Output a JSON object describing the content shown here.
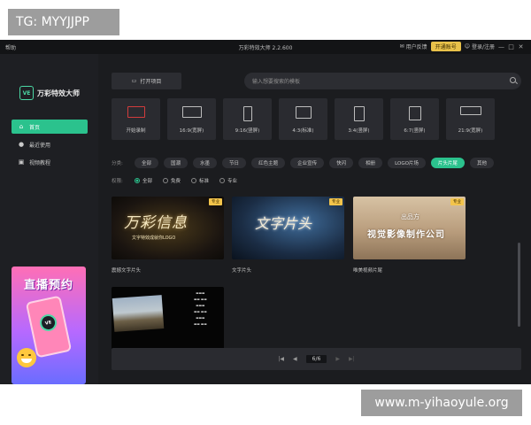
{
  "watermarks": {
    "top": "TG: MYYJJPP",
    "bottom": "www.m-yihaoyule.org"
  },
  "titlebar": {
    "help": "帮助",
    "title": "万彩特效大师 2.2.600",
    "feedback": "用户反馈",
    "upgrade": "开通账号",
    "login": "登录/注册",
    "window_buttons": [
      "—",
      "□",
      "✕"
    ]
  },
  "sidebar": {
    "logo_badge": "VE",
    "logo_text": "万彩特效大师",
    "items": [
      {
        "label": "首页",
        "icon": "home-icon",
        "glyph": "⌂",
        "active": true
      },
      {
        "label": "最近使用",
        "icon": "recent-icon",
        "glyph": "●",
        "active": false
      },
      {
        "label": "视频教程",
        "icon": "video-icon",
        "glyph": "▣",
        "active": false
      }
    ],
    "promo": {
      "title": "直播预约",
      "badge": "VE"
    }
  },
  "main": {
    "open_project": "打开项目",
    "search_placeholder": "输入想要搜索的模板",
    "ratios": [
      {
        "label": "开始录制",
        "shape": "custom"
      },
      {
        "label": "16:9(宽屏)",
        "shape": "wide"
      },
      {
        "label": "9:16(竖屏)",
        "shape": "tall"
      },
      {
        "label": "4:3(标准)",
        "shape": "std"
      },
      {
        "label": "3:4(竖屏)",
        "shape": "stdtall"
      },
      {
        "label": "6:7(竖屏)",
        "shape": "square"
      },
      {
        "label": "21:9(宽屏)",
        "shape": "ultra"
      }
    ],
    "category_label": "分类:",
    "categories": [
      {
        "label": "全部",
        "active": false
      },
      {
        "label": "国潮",
        "active": false
      },
      {
        "label": "水墨",
        "active": false
      },
      {
        "label": "节日",
        "active": false
      },
      {
        "label": "红色主题",
        "active": false
      },
      {
        "label": "企业宣传",
        "active": false
      },
      {
        "label": "快闪",
        "active": false
      },
      {
        "label": "相册",
        "active": false
      },
      {
        "label": "LOGO片场",
        "active": false
      },
      {
        "label": "片头片尾",
        "active": true
      },
      {
        "label": "其他",
        "active": false
      }
    ],
    "usage_label": "权限:",
    "usage_options": [
      {
        "label": "全部",
        "selected": true
      },
      {
        "label": "免费",
        "selected": false
      },
      {
        "label": "标准",
        "selected": false
      },
      {
        "label": "专业",
        "selected": false
      }
    ],
    "templates": [
      {
        "name": "震撼文字片头",
        "tag": "专业",
        "headline": "万彩信息",
        "subline": "文字特效成就你LOGO"
      },
      {
        "name": "文字片头",
        "tag": "专业",
        "headline": "文字片头",
        "subline": ""
      },
      {
        "name": "唯美视频片尾",
        "tag": "专业",
        "headline": "出品方",
        "subline": "视觉影像制作公司"
      },
      {
        "name": "",
        "tag": "",
        "headline": "",
        "subline": ""
      }
    ],
    "pager": {
      "page": "6/6",
      "first": "|◀",
      "prev": "◀",
      "next": "▶",
      "last": "▶|"
    }
  },
  "colors": {
    "accent": "#2bc28d",
    "upgrade": "#e8c14a",
    "panel": "#2a2b30",
    "bg": "#1b1c1f"
  }
}
